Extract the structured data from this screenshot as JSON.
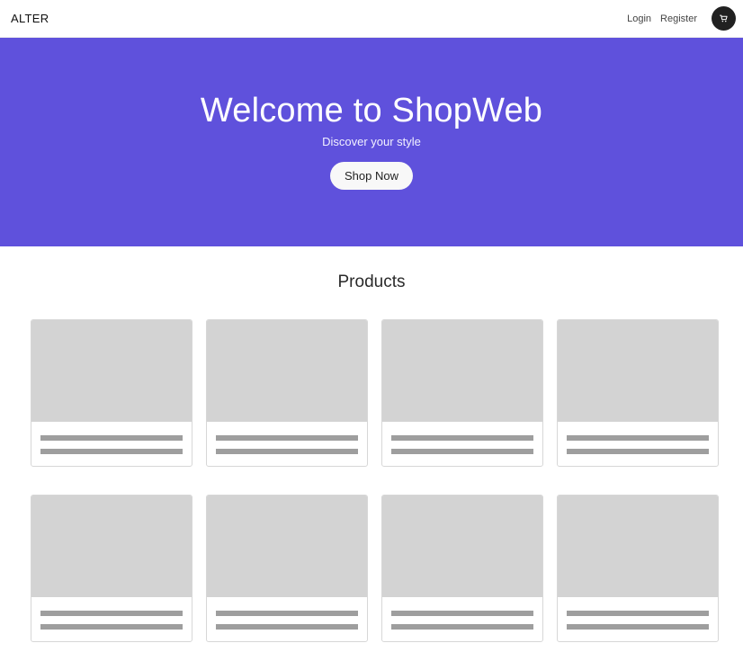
{
  "navbar": {
    "brand": "ALTER",
    "login_label": "Login",
    "register_label": "Register",
    "cart_icon": "shopping-cart-icon",
    "cart_bg_color": "#212121"
  },
  "hero": {
    "title": "Welcome to ShopWeb",
    "subtitle": "Discover your style",
    "cta_label": "Shop Now",
    "bg_color": "#5f51dc"
  },
  "products": {
    "title": "Products",
    "card_count": 8,
    "placeholder_image_color": "#d3d3d3",
    "placeholder_text_color": "#9e9e9e"
  }
}
